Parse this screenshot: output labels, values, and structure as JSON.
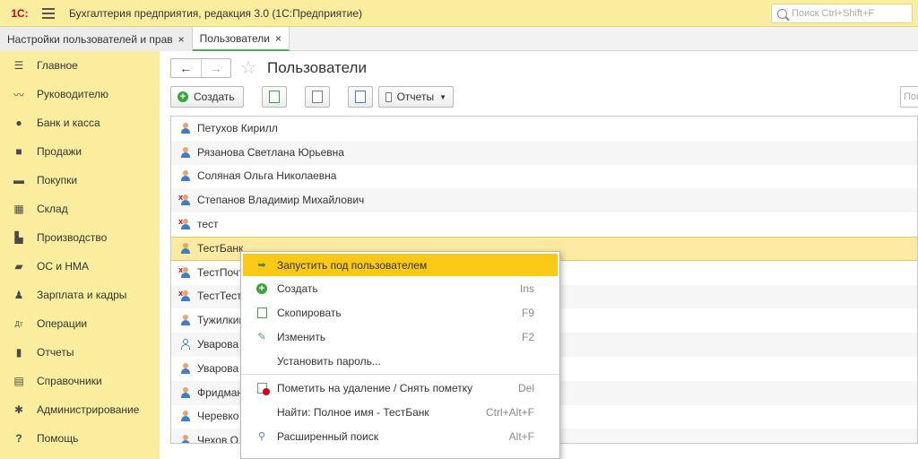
{
  "app": {
    "logo": "1С:",
    "title": "Бухгалтерия предприятия, редакция 3.0  (1С:Предприятие)",
    "search_placeholder": "Поиск Ctrl+Shift+F"
  },
  "tabs": [
    {
      "label": "Настройки пользователей и прав",
      "close": "×"
    },
    {
      "label": "Пользователи",
      "close": "×"
    }
  ],
  "sidebar": {
    "items": [
      {
        "label": "Главное",
        "icon": "menu-icon"
      },
      {
        "label": "Руководителю",
        "icon": "trend-icon"
      },
      {
        "label": "Банк и касса",
        "icon": "coin-icon"
      },
      {
        "label": "Продажи",
        "icon": "bag-icon"
      },
      {
        "label": "Покупки",
        "icon": "cart-icon"
      },
      {
        "label": "Склад",
        "icon": "grid-icon"
      },
      {
        "label": "Производство",
        "icon": "factory-icon"
      },
      {
        "label": "ОС и НМА",
        "icon": "truck-icon"
      },
      {
        "label": "Зарплата и кадры",
        "icon": "person-icon"
      },
      {
        "label": "Операции",
        "icon": "dt-kt-icon"
      },
      {
        "label": "Отчеты",
        "icon": "bars-icon"
      },
      {
        "label": "Справочники",
        "icon": "book-icon"
      },
      {
        "label": "Администрирование",
        "icon": "gear-icon"
      },
      {
        "label": "Помощь",
        "icon": "question-icon"
      }
    ]
  },
  "main": {
    "nav_back": "←",
    "nav_forward": "→",
    "title": "Пользователи",
    "toolbar": {
      "create_label": "Создать",
      "reports_label": "Отчеты",
      "search_placeholder": "Пои"
    },
    "rows": [
      {
        "name": "Петухов Кирилл",
        "state": "normal"
      },
      {
        "name": "Рязанова Светлана Юрьевна",
        "state": "normal"
      },
      {
        "name": "Соляная Ольга Николаевна",
        "state": "normal"
      },
      {
        "name": "Степанов Владимир Михайлович",
        "state": "marked"
      },
      {
        "name": "тест",
        "state": "marked"
      },
      {
        "name": "ТестБанк",
        "state": "normal"
      },
      {
        "name": "ТестПочт",
        "state": "marked"
      },
      {
        "name": "ТестТест",
        "state": "marked"
      },
      {
        "name": "Тужилкин",
        "state": "normal"
      },
      {
        "name": "Уварова",
        "state": "outline"
      },
      {
        "name": "Уварова",
        "state": "normal"
      },
      {
        "name": "Фридман",
        "state": "normal"
      },
      {
        "name": "Черевко",
        "state": "normal"
      },
      {
        "name": "Чехов О",
        "state": "normal"
      }
    ]
  },
  "context_menu": {
    "items": [
      {
        "label": "Запустить под пользователем",
        "shortcut": "",
        "icon": "arrow-run-icon"
      },
      {
        "label": "Создать",
        "shortcut": "Ins",
        "icon": "plus-circle-icon"
      },
      {
        "label": "Скопировать",
        "shortcut": "F9",
        "icon": "copy-icon"
      },
      {
        "label": "Изменить",
        "shortcut": "F2",
        "icon": "pencil-icon"
      },
      {
        "label": "Установить пароль...",
        "shortcut": "",
        "icon": ""
      },
      {
        "label": "Пометить на удаление / Снять пометку",
        "shortcut": "Del",
        "icon": "delete-mark-icon"
      },
      {
        "label": "Найти: Полное имя - ТестБанк",
        "shortcut": "Ctrl+Alt+F",
        "icon": ""
      },
      {
        "label": "Расширенный поиск",
        "shortcut": "Alt+F",
        "icon": "search-icon"
      }
    ]
  },
  "colors": {
    "sidebar_bg": "#fbed9e",
    "highlight": "#f9c916",
    "selected_row": "#fbeaa0",
    "accent_green": "#3ba53b"
  }
}
